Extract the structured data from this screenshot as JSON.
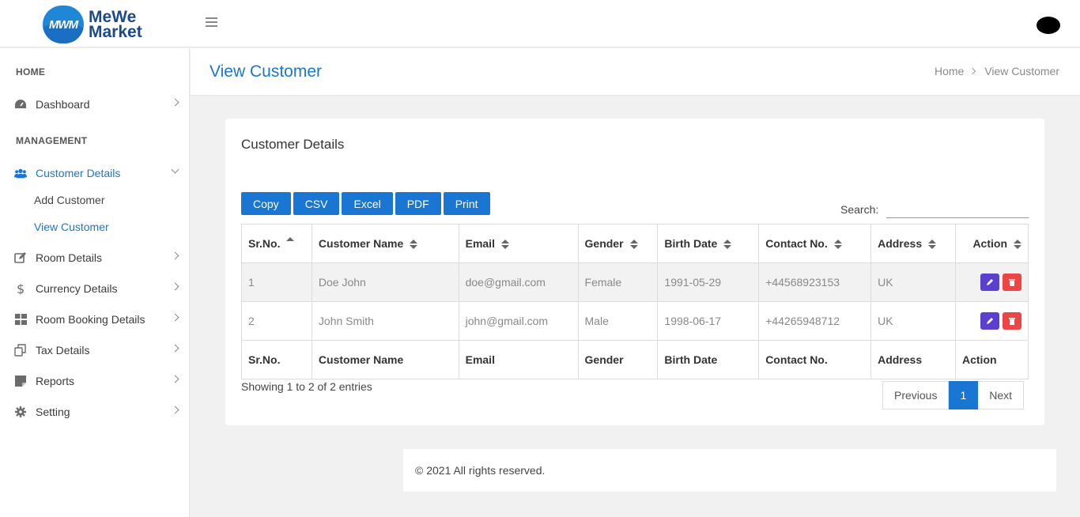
{
  "brand": {
    "badge": "MWM",
    "line1": "MeWe",
    "line2": "Market"
  },
  "sidebar": {
    "home_heading": "HOME",
    "management_heading": "MANAGEMENT",
    "items": [
      {
        "label": "Dashboard",
        "icon": "dashboard-icon"
      },
      {
        "label": "Customer Details",
        "icon": "users-icon"
      },
      {
        "label": "Room Details",
        "icon": "edit-icon"
      },
      {
        "label": "Currency Details",
        "icon": "dollar-icon"
      },
      {
        "label": "Room Booking Details",
        "icon": "grid-icon"
      },
      {
        "label": "Tax Details",
        "icon": "copy-icon"
      },
      {
        "label": "Reports",
        "icon": "note-icon"
      },
      {
        "label": "Setting",
        "icon": "gear-icon"
      }
    ],
    "sub_items": [
      {
        "label": "Add Customer"
      },
      {
        "label": "View Customer"
      }
    ]
  },
  "page": {
    "title": "View Customer",
    "breadcrumb": [
      "Home",
      "View Customer"
    ]
  },
  "card": {
    "title": "Customer Details",
    "buttons": [
      "Copy",
      "CSV",
      "Excel",
      "PDF",
      "Print"
    ],
    "search_label": "Search:",
    "search_value": "",
    "columns": [
      "Sr.No.",
      "Customer Name",
      "Email",
      "Gender",
      "Birth Date",
      "Contact No.",
      "Address",
      "Action"
    ],
    "rows": [
      {
        "sr": "1",
        "name": "Doe John",
        "email": "doe@gmail.com",
        "gender": "Female",
        "birth": "1991-05-29",
        "contact": "+44568923153",
        "address": "UK"
      },
      {
        "sr": "2",
        "name": "John Smith",
        "email": "john@gmail.com",
        "gender": "Male",
        "birth": "1998-06-17",
        "contact": "+44265948712",
        "address": "UK"
      }
    ],
    "info": "Showing 1 to 2 of 2 entries",
    "pager": {
      "prev": "Previous",
      "current": "1",
      "next": "Next"
    }
  },
  "footer": {
    "text": "© 2021 All rights reserved."
  },
  "colors": {
    "accent": "#1976d2",
    "edit": "#5b3fd0",
    "delete": "#ef4444"
  }
}
